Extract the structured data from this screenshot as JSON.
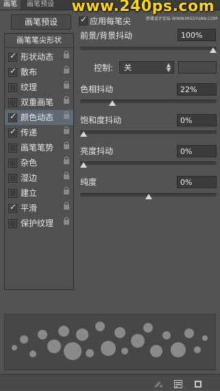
{
  "tabs": [
    {
      "label": "画笔"
    },
    {
      "label": "画笔预设"
    }
  ],
  "watermark": {
    "text": "www.240ps.com",
    "sub": "思缘设计论坛 WWW.MISSYUAN.COM"
  },
  "presets_button": "画笔预设",
  "left_list": {
    "header": "画笔笔尖形状",
    "items": [
      {
        "label": "形状动态",
        "checked": true
      },
      {
        "label": "散布",
        "checked": true
      },
      {
        "label": "纹理",
        "checked": false
      },
      {
        "label": "双重画笔",
        "checked": false
      },
      {
        "label": "颜色动态",
        "checked": true,
        "selected": true
      },
      {
        "label": "传递",
        "checked": true
      },
      {
        "label": "画笔笔势",
        "checked": false
      },
      {
        "label": "杂色",
        "checked": false
      },
      {
        "label": "湿边",
        "checked": false
      },
      {
        "label": "建立",
        "checked": false
      },
      {
        "label": "平滑",
        "checked": true
      },
      {
        "label": "保护纹理",
        "checked": false
      }
    ]
  },
  "color_dynamics": {
    "apply_per_tip": {
      "label": "应用每笔尖",
      "checked": true
    },
    "fg_bg_jitter": {
      "label": "前景/背景抖动",
      "value": "100%",
      "level": 1.0
    },
    "control": {
      "label": "控制:",
      "value": "关"
    },
    "hue_jitter": {
      "label": "色相抖动",
      "value": "22%",
      "level": 0.22
    },
    "saturation_jitter": {
      "label": "饱和度抖动",
      "value": "0%",
      "level": 0
    },
    "brightness_jitter": {
      "label": "亮度抖动",
      "value": "0%",
      "level": 0
    },
    "purity": {
      "label": "纯度",
      "value": "0%",
      "level": 0.5
    }
  },
  "tick": "✓"
}
